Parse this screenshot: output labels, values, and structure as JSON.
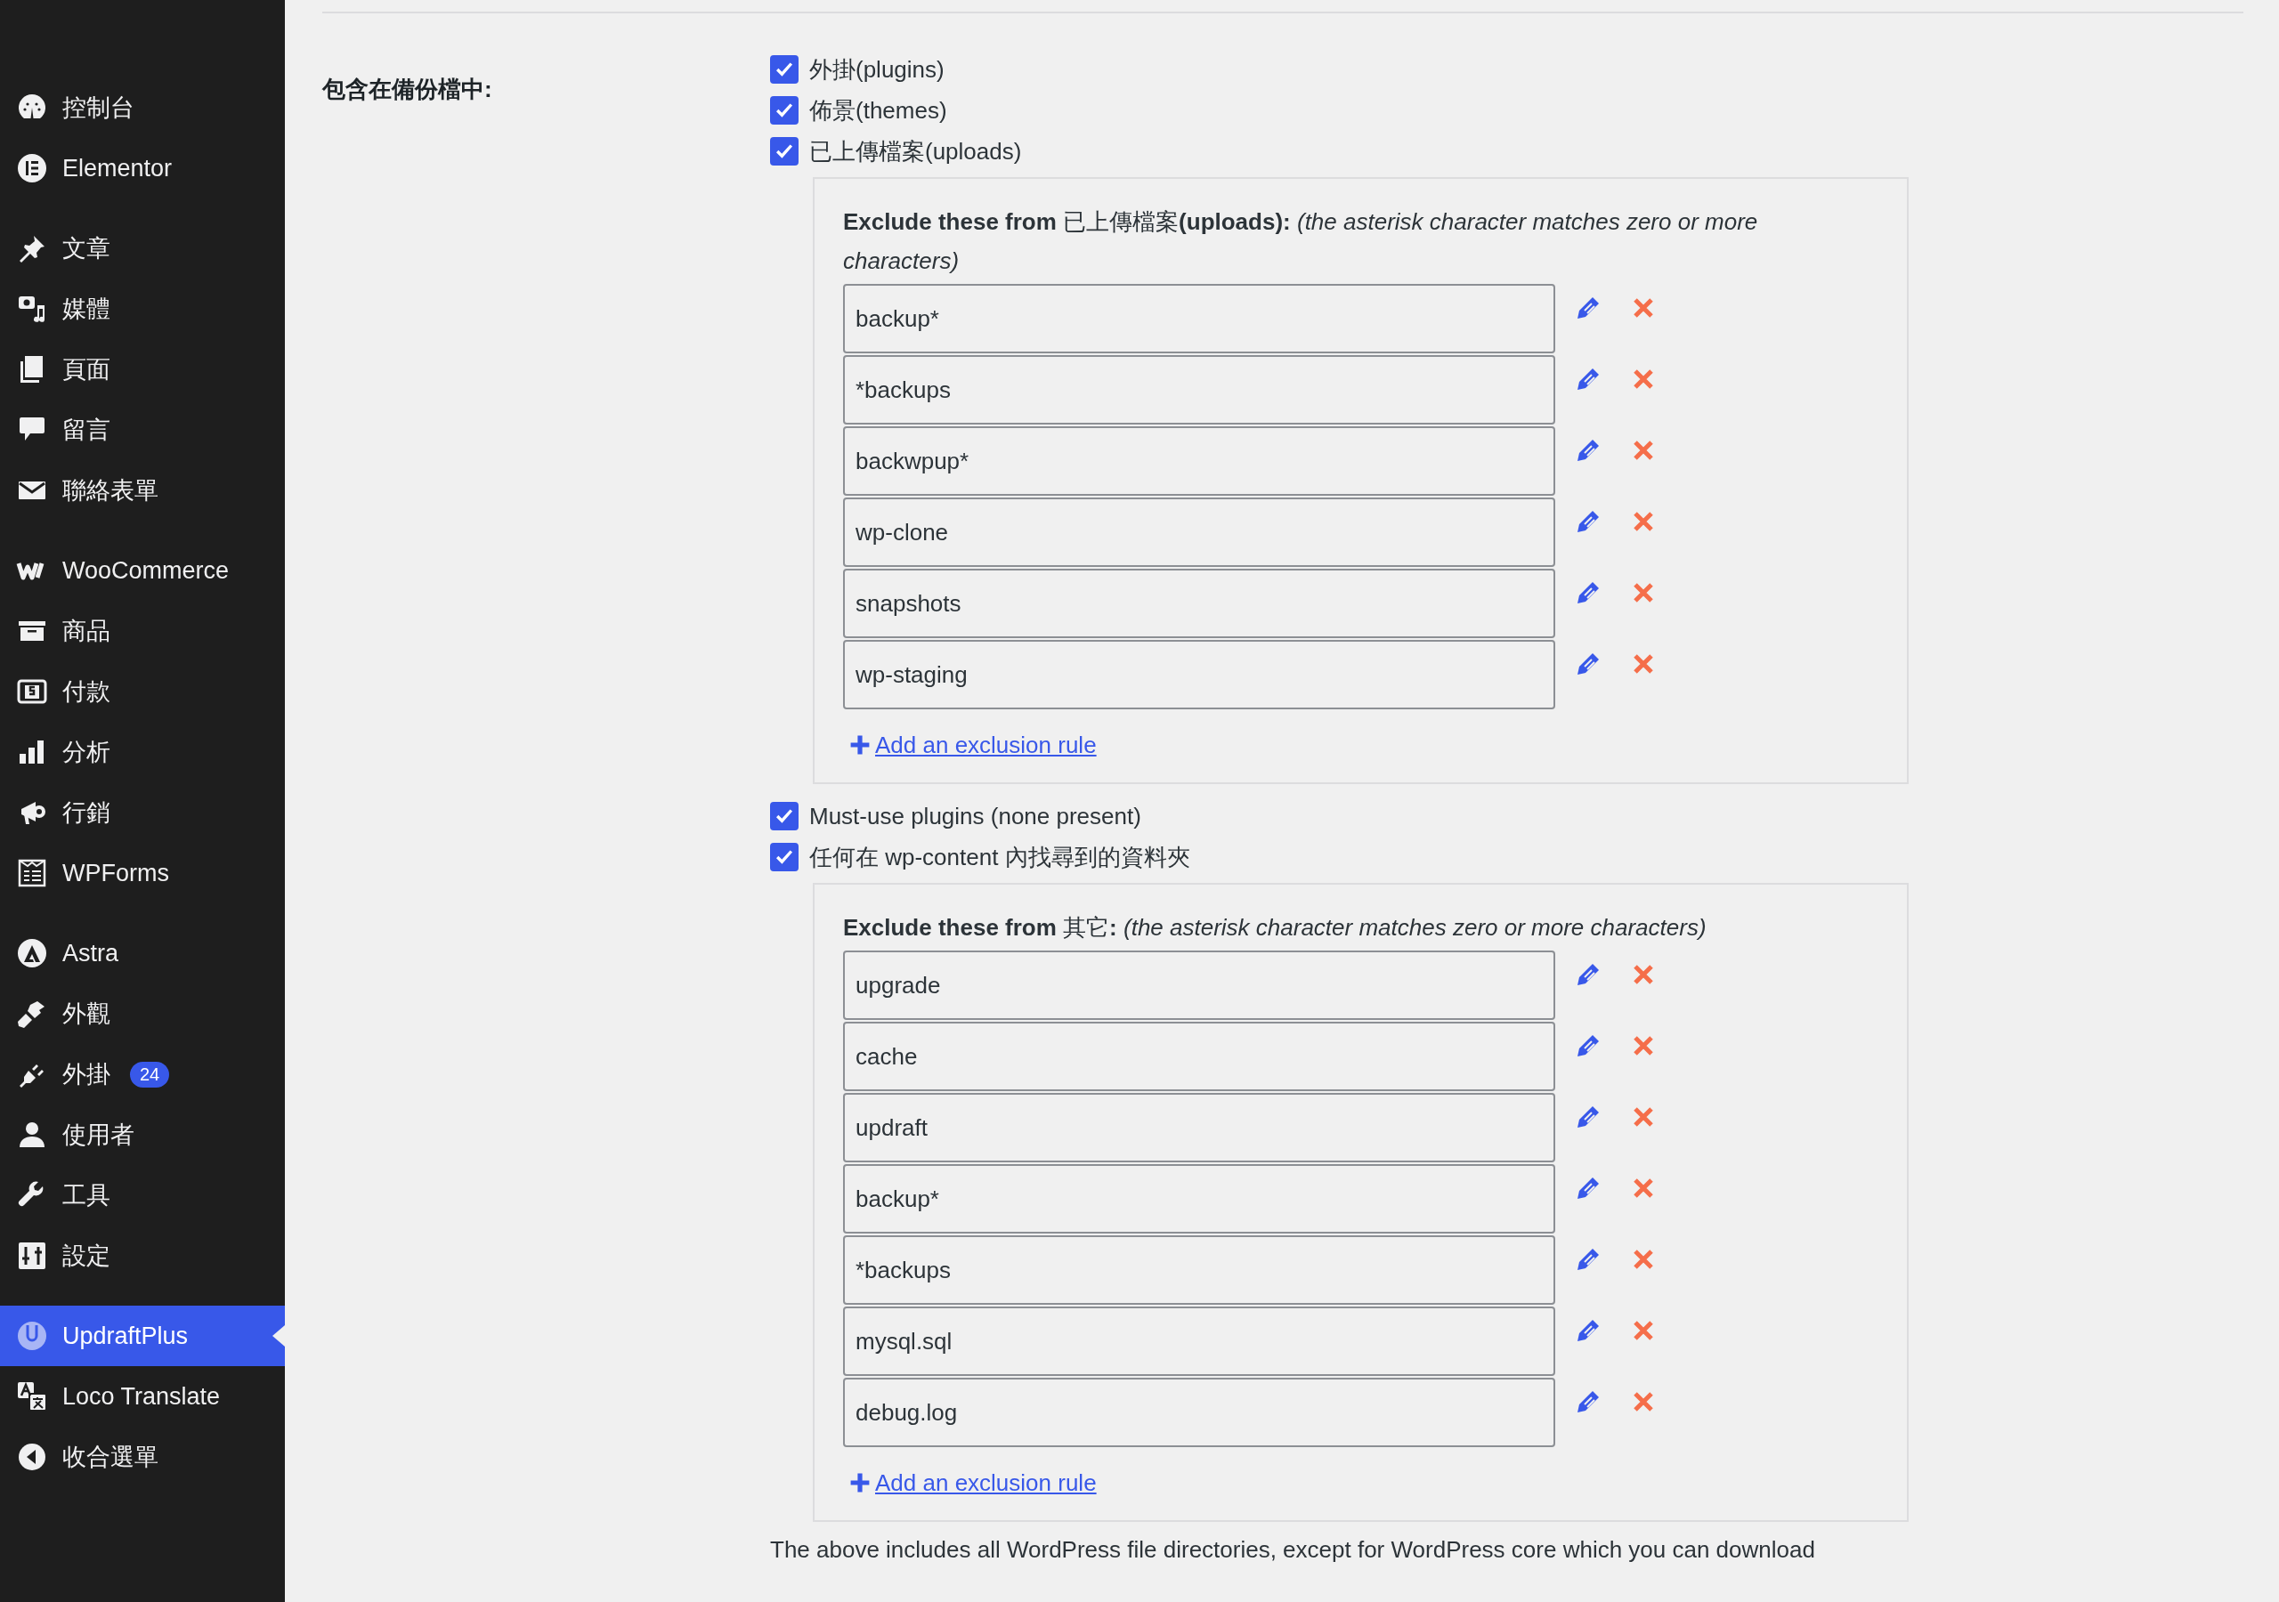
{
  "sidebar": {
    "groups": [
      [
        {
          "label": "控制台",
          "selected": false
        },
        {
          "label": "Elementor",
          "selected": false
        }
      ],
      [
        {
          "label": "文章",
          "selected": false
        },
        {
          "label": "媒體",
          "selected": false
        },
        {
          "label": "頁面",
          "selected": false
        },
        {
          "label": "留言",
          "selected": false
        },
        {
          "label": "聯絡表單",
          "selected": false
        }
      ],
      [
        {
          "label": "WooCommerce",
          "selected": false
        },
        {
          "label": "商品",
          "selected": false
        },
        {
          "label": "付款",
          "selected": false
        },
        {
          "label": "分析",
          "selected": false
        },
        {
          "label": "行銷",
          "selected": false
        },
        {
          "label": "WPForms",
          "selected": false
        }
      ],
      [
        {
          "label": "Astra",
          "selected": false
        },
        {
          "label": "外觀",
          "selected": false
        },
        {
          "label": "外掛",
          "selected": false,
          "badge": "24"
        },
        {
          "label": "使用者",
          "selected": false
        },
        {
          "label": "工具",
          "selected": false
        },
        {
          "label": "設定",
          "selected": false
        }
      ],
      [
        {
          "label": "UpdraftPlus",
          "selected": true
        },
        {
          "label": "Loco Translate",
          "selected": false
        },
        {
          "label": "收合選單",
          "selected": false
        }
      ]
    ]
  },
  "backup_section": {
    "label": "包含在備份檔中:",
    "options": [
      {
        "kind": "checkbox",
        "label": "外掛(plugins)",
        "checked": true
      },
      {
        "kind": "checkbox",
        "label": "佈景(themes)",
        "checked": true
      },
      {
        "kind": "checkbox",
        "label": "已上傳檔案(uploads)",
        "checked": true
      },
      {
        "kind": "exclusions",
        "heading": "**Exclude these from** 已上傳檔案**(uploads):** *(the asterisk character matches zero or more characters)*",
        "rules": [
          "backup*",
          "*backups",
          "backwpup*",
          "wp-clone",
          "snapshots",
          "wp-staging"
        ],
        "add_link": "Add an exclusion rule"
      },
      {
        "kind": "checkbox",
        "label": "Must-use plugins (none present)",
        "checked": true
      },
      {
        "kind": "checkbox",
        "label": "任何在 wp-content 內找尋到的資料夾",
        "checked": true
      },
      {
        "kind": "exclusions",
        "heading": "**Exclude these from** 其它**:** *(the asterisk character matches zero or more characters)*",
        "rules": [
          "upgrade",
          "cache",
          "updraft",
          "backup*",
          "*backups",
          "mysql.sql",
          "debug.log"
        ],
        "add_link": "Add an exclusion rule"
      }
    ],
    "note": "The above includes all WordPress file directories, except for WordPress core which you can download"
  }
}
